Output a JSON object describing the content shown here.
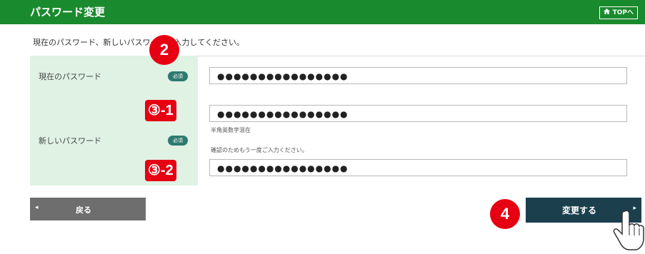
{
  "header": {
    "title": "パスワード変更",
    "top_label": "TOPへ"
  },
  "instruction": "現在のパスワード、新しいパスワードを入力してください。",
  "rows": [
    {
      "label": "現在のパスワード",
      "required": "必須",
      "value": "●●●●●●●●●●●●●●●●"
    },
    {
      "label": "新しいパスワード",
      "required": "必須",
      "value1": "●●●●●●●●●●●●●●●●",
      "hint1": "半角英数字混在",
      "hint2": "確認のためもう一度ご入力ください。",
      "value2": "●●●●●●●●●●●●●●●●"
    }
  ],
  "buttons": {
    "back": "戻る",
    "submit": "変更する"
  },
  "badges": {
    "b2": "2",
    "b3_1": "③-1",
    "b3_2": "③-2",
    "b4": "4"
  },
  "colors": {
    "header": "#1a8a2e",
    "label_bg": "#dff2e4",
    "badge": "#e60012",
    "submit": "#1b3f4d",
    "back": "#6e6e6e",
    "required": "#2d7a6e"
  }
}
